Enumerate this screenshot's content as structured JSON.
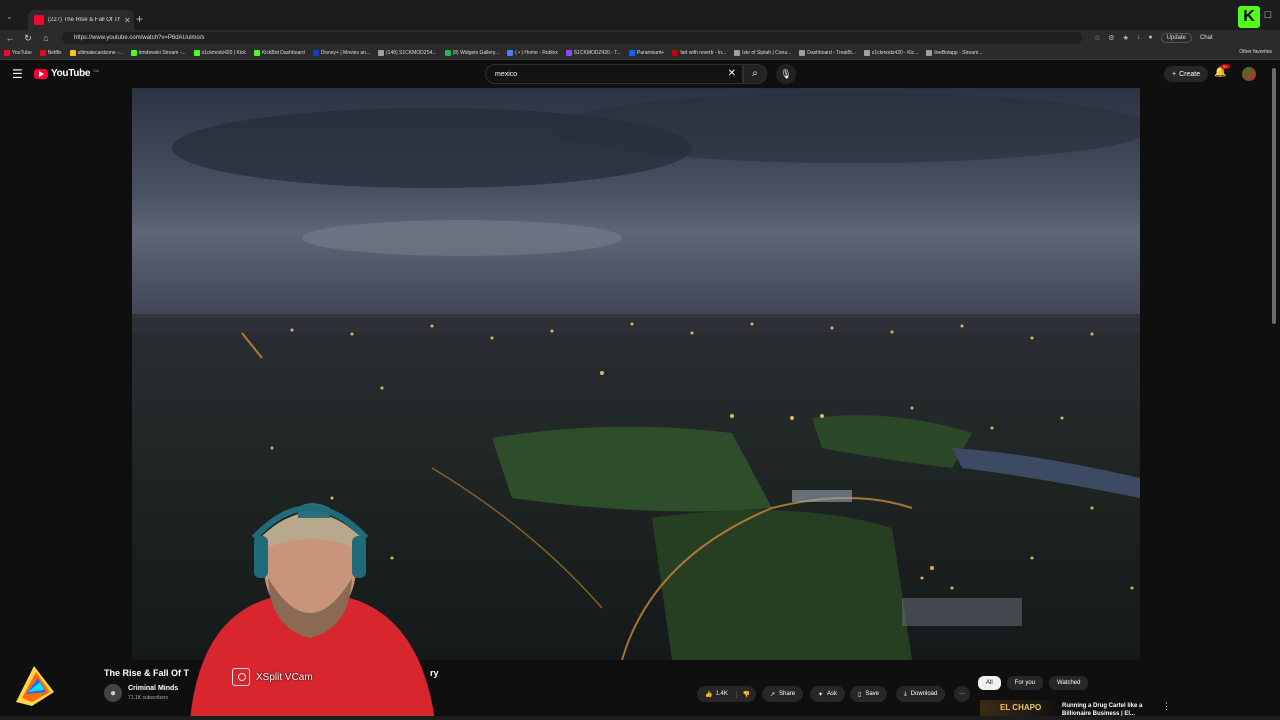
{
  "browser": {
    "tab_title": "(227) The Rise & Fall Of The",
    "url": "https://www.youtube.com/watch?v=P6dAUulmo/s",
    "update_label": "Update",
    "chat_label": "Chat",
    "other_favorites": "Other favorites",
    "bookmarks": [
      {
        "label": "YouTube",
        "color": "#ff0033"
      },
      {
        "label": "Netflix",
        "color": "#e50914"
      },
      {
        "label": "ultimatecardzone -...",
        "color": "#f5c518"
      },
      {
        "label": "timdewski Stream -...",
        "color": "#53fc18"
      },
      {
        "label": "s1ckmodz420 | Kick",
        "color": "#53fc18"
      },
      {
        "label": "KickBot Dashboard",
        "color": "#53fc18"
      },
      {
        "label": "Disney+ | Movies an...",
        "color": "#113ccf"
      },
      {
        "label": "(148) S1CKMODZ54...",
        "color": "#9aa0a6"
      },
      {
        "label": "(8) Widgets Gallery...",
        "color": "#1db954"
      },
      {
        "label": "( • ) Home - Roblox",
        "color": "#4a7bff"
      },
      {
        "label": "S1CKMODZ420 - T...",
        "color": "#9146ff"
      },
      {
        "label": "Paramount+",
        "color": "#0064ff"
      },
      {
        "label": "fart with reverb - In...",
        "color": "#cc0000"
      },
      {
        "label": "Isle of Siptah | Cona...",
        "color": "#9aa0a6"
      },
      {
        "label": "Dashboard - Treat5t...",
        "color": "#9aa0a6"
      },
      {
        "label": "s1ckmodz420 - Kic...",
        "color": "#9aa0a6"
      },
      {
        "label": "liveBotapp - Stream...",
        "color": "#9aa0a6"
      }
    ]
  },
  "youtube": {
    "logo_text": "YouTube",
    "country_code": "CA",
    "search_value": "mexico",
    "create_label": "Create",
    "notif_badge": "9+"
  },
  "video": {
    "title": "The Rise & Fall Of T",
    "title_tail": "ry",
    "channel": "Criminal Minds",
    "subscribers": "71.1K subscribers",
    "likes": "1.4K",
    "share_label": "Share",
    "ask_label": "Ask",
    "save_label": "Save",
    "download_label": "Download"
  },
  "sidebar": {
    "chips": [
      "All",
      "For you",
      "Watched"
    ],
    "recommendation": {
      "thumb_text": "EL CHAPO",
      "title": "Running a Drug Cartel like a Billionaire Business | El..."
    }
  },
  "overlay": {
    "webcam_label": "XSplit VCam",
    "kick_badge": "K"
  }
}
